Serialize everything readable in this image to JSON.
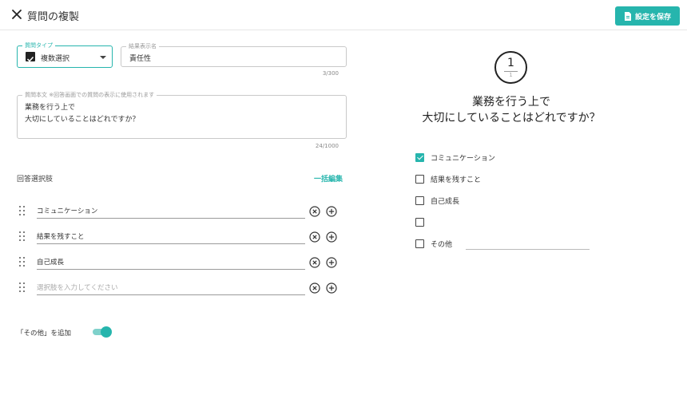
{
  "header": {
    "title": "質問の複製",
    "save_label": "設定を保存"
  },
  "question_type": {
    "legend": "質問タイプ",
    "value": "複数選択"
  },
  "result_name": {
    "legend": "結果表示名",
    "value": "責任性",
    "counter": "3/300"
  },
  "question_text": {
    "legend": "質問本文 ※回答画面での質問の表示に使用されます",
    "line1": "業務を行う上で",
    "line2": "大切にしていることはどれですか？",
    "counter": "24/1000"
  },
  "choices": {
    "title": "回答選択肢",
    "bulk_edit": "一括編集",
    "items": [
      {
        "value": "コミュニケーション"
      },
      {
        "value": "結果を残すこと"
      },
      {
        "value": "自己成長"
      },
      {
        "placeholder": "選択肢を入力してください"
      }
    ]
  },
  "add_other": {
    "label": "「その他」を追加",
    "enabled": true
  },
  "preview": {
    "number": "1",
    "total": "1",
    "question_line1": "業務を行う上で",
    "question_line2": "大切にしていることはどれですか？",
    "options": [
      {
        "label": "コミュニケーション",
        "checked": true
      },
      {
        "label": "結果を残すこと",
        "checked": false
      },
      {
        "label": "自己成長",
        "checked": false
      },
      {
        "label": "",
        "checked": false
      },
      {
        "label": "その他",
        "checked": false
      }
    ]
  },
  "colors": {
    "accent": "#26b5ad",
    "border": "#c9c9c9",
    "text": "#333333"
  }
}
